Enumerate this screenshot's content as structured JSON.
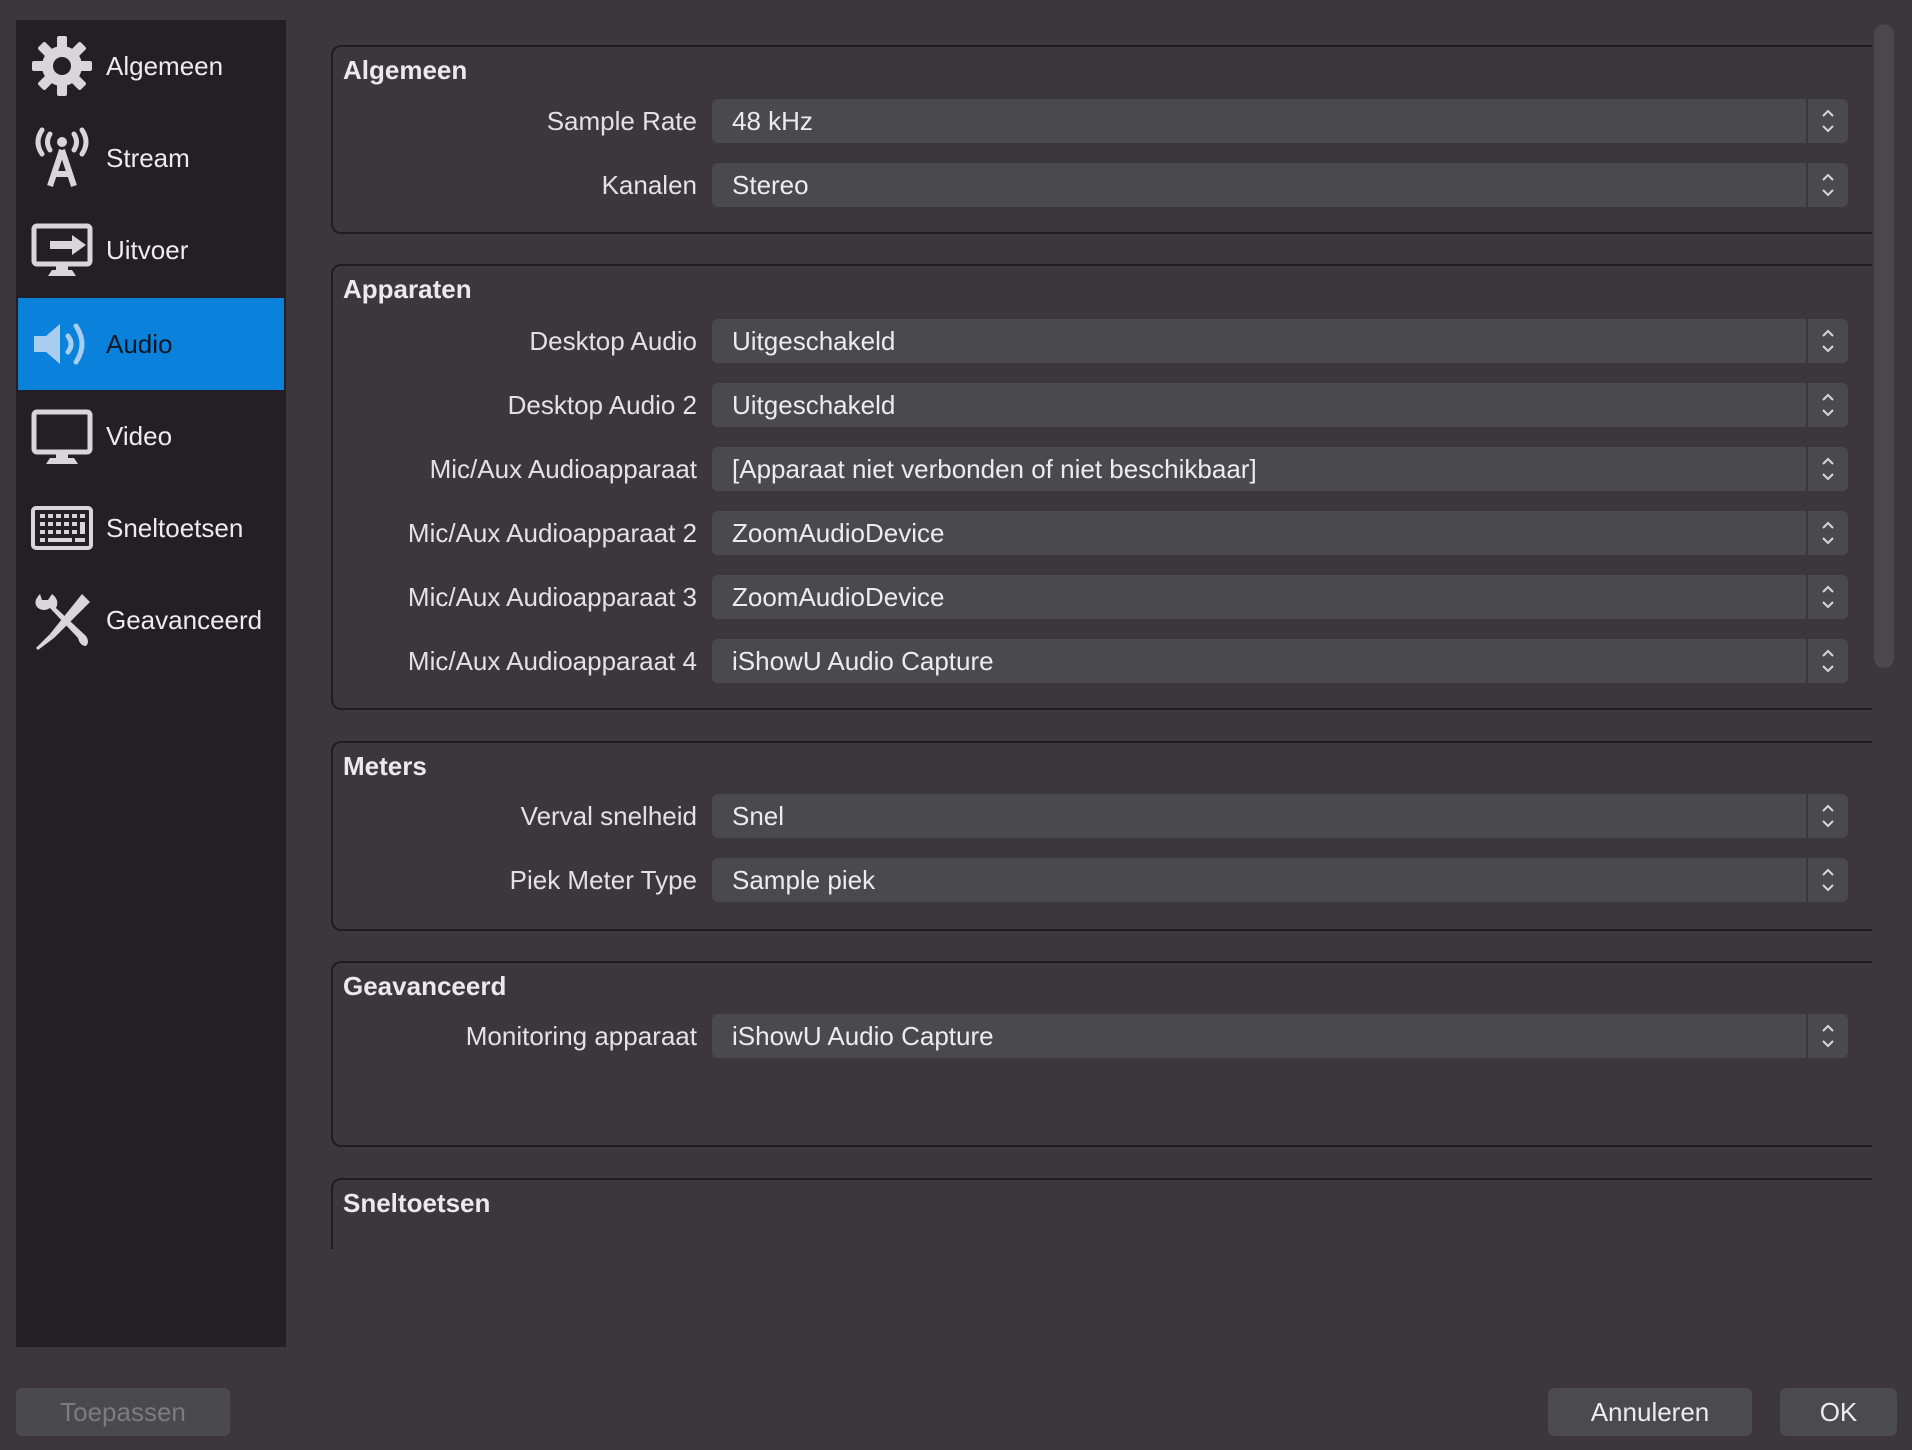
{
  "sidebar": {
    "items": [
      {
        "label": "Algemeen",
        "icon": "gear-icon",
        "active": false
      },
      {
        "label": "Stream",
        "icon": "antenna-icon",
        "active": false
      },
      {
        "label": "Uitvoer",
        "icon": "output-monitor-icon",
        "active": false
      },
      {
        "label": "Audio",
        "icon": "speaker-icon",
        "active": true
      },
      {
        "label": "Video",
        "icon": "monitor-icon",
        "active": false
      },
      {
        "label": "Sneltoetsen",
        "icon": "keyboard-icon",
        "active": false
      },
      {
        "label": "Geavanceerd",
        "icon": "tools-icon",
        "active": false
      }
    ]
  },
  "groups": {
    "general": {
      "title": "Algemeen",
      "rows": [
        {
          "label": "Sample Rate",
          "value": "48 kHz"
        },
        {
          "label": "Kanalen",
          "value": "Stereo"
        }
      ]
    },
    "devices": {
      "title": "Apparaten",
      "rows": [
        {
          "label": "Desktop Audio",
          "value": "Uitgeschakeld"
        },
        {
          "label": "Desktop Audio 2",
          "value": "Uitgeschakeld"
        },
        {
          "label": "Mic/Aux Audioapparaat",
          "value": "[Apparaat niet verbonden of niet beschikbaar]"
        },
        {
          "label": "Mic/Aux Audioapparaat 2",
          "value": "ZoomAudioDevice"
        },
        {
          "label": "Mic/Aux Audioapparaat 3",
          "value": "ZoomAudioDevice"
        },
        {
          "label": "Mic/Aux Audioapparaat 4",
          "value": "iShowU Audio Capture"
        }
      ]
    },
    "meters": {
      "title": "Meters",
      "rows": [
        {
          "label": "Verval snelheid",
          "value": "Snel"
        },
        {
          "label": "Piek Meter Type",
          "value": "Sample piek"
        }
      ]
    },
    "advanced": {
      "title": "Geavanceerd",
      "rows": [
        {
          "label": "Monitoring apparaat",
          "value": "iShowU Audio Capture"
        }
      ]
    },
    "hotkeys": {
      "title": "Sneltoetsen"
    }
  },
  "footer": {
    "apply_label": "Toepassen",
    "cancel_label": "Annuleren",
    "ok_label": "OK"
  },
  "colors": {
    "accent": "#0a82dc",
    "background": "#3b373d",
    "sidebar": "#231f25",
    "combo": "#4a4a4c"
  }
}
